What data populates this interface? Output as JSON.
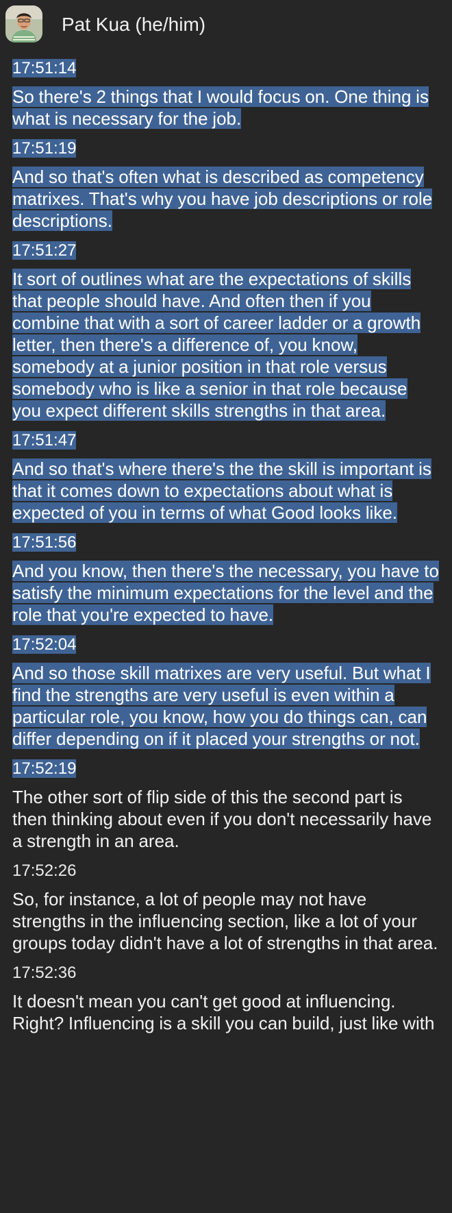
{
  "header": {
    "speaker": "Pat Kua (he/him)"
  },
  "entries": [
    {
      "time": "17:51:14",
      "text": "So there's 2 things that I would focus on. One thing is what is necessary for the job.",
      "selected": true
    },
    {
      "time": "17:51:19",
      "text": "And so that's often what is described as competency matrixes. That's why you have job descriptions or role descriptions.",
      "selected": true
    },
    {
      "time": "17:51:27",
      "text": "It sort of outlines what are the expectations of skills that people should have. And often then if you combine that with a sort of career ladder or a growth letter, then there's a difference of, you know, somebody at a junior position in that role versus somebody who is like a senior in that role because you expect different skills strengths in that area.",
      "selected": true
    },
    {
      "time": "17:51:47",
      "text": "And so that's where there's the the skill is important is that it comes down to expectations about what is expected of you in terms of what Good looks like.",
      "selected": true
    },
    {
      "time": "17:51:56",
      "text": "And you know, then there's the necessary, you have to satisfy the minimum expectations for the level and the role that you're expected to have.",
      "selected": true
    },
    {
      "time": "17:52:04",
      "text": "And so those skill matrixes are very useful. But what I find the strengths are very useful is even within a particular role, you know, how you do things can, can differ depending on if it placed your strengths or not.",
      "selected": true
    },
    {
      "time": "17:52:19",
      "text": "The other sort of flip side of this the second part is then thinking about even if you don't necessarily have a strength in an area.",
      "selected": false,
      "time_selected": true
    },
    {
      "time": "17:52:26",
      "text": "So, for instance, a lot of people may not have strengths in the influencing section, like a lot of your groups today didn't have a lot of strengths in that area.",
      "selected": false
    },
    {
      "time": "17:52:36",
      "text": "It doesn't mean you can't get good at influencing. Right? Influencing is a skill you can build, just like with",
      "selected": false
    }
  ],
  "colors": {
    "background": "#262626",
    "selection": "#3f6394",
    "text": "#f2f2f2"
  }
}
